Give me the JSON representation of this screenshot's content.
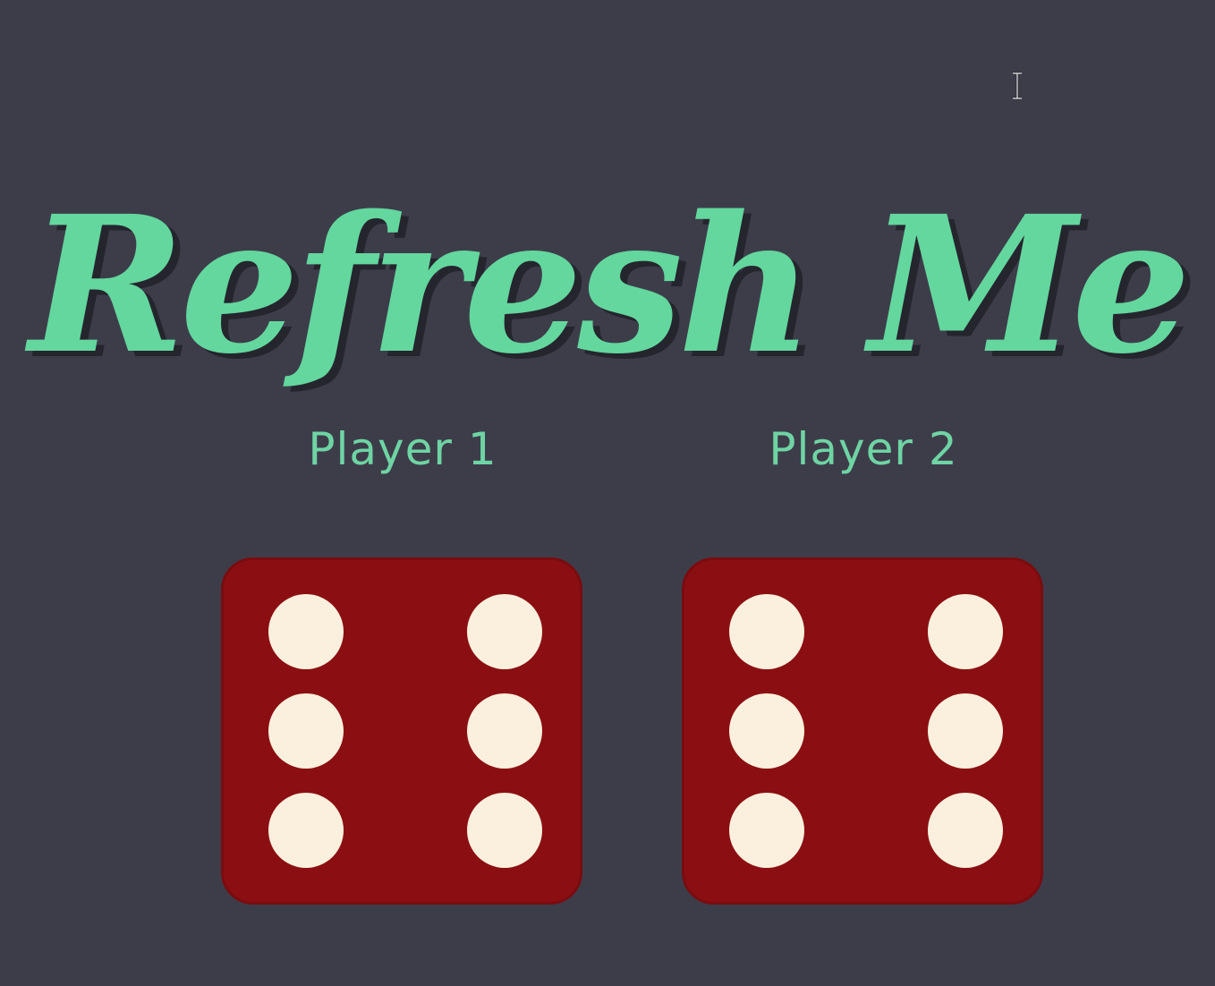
{
  "header": {
    "title": "Refresh Me"
  },
  "players": [
    {
      "label": "Player 1",
      "die_value": 6
    },
    {
      "label": "Player 2",
      "die_value": 6
    }
  ],
  "colors": {
    "background": "#3d3d4a",
    "title": "#63d79e",
    "player_label": "#6fd4a4",
    "die": "#8b0f12",
    "pip": "#fbf0dd"
  }
}
